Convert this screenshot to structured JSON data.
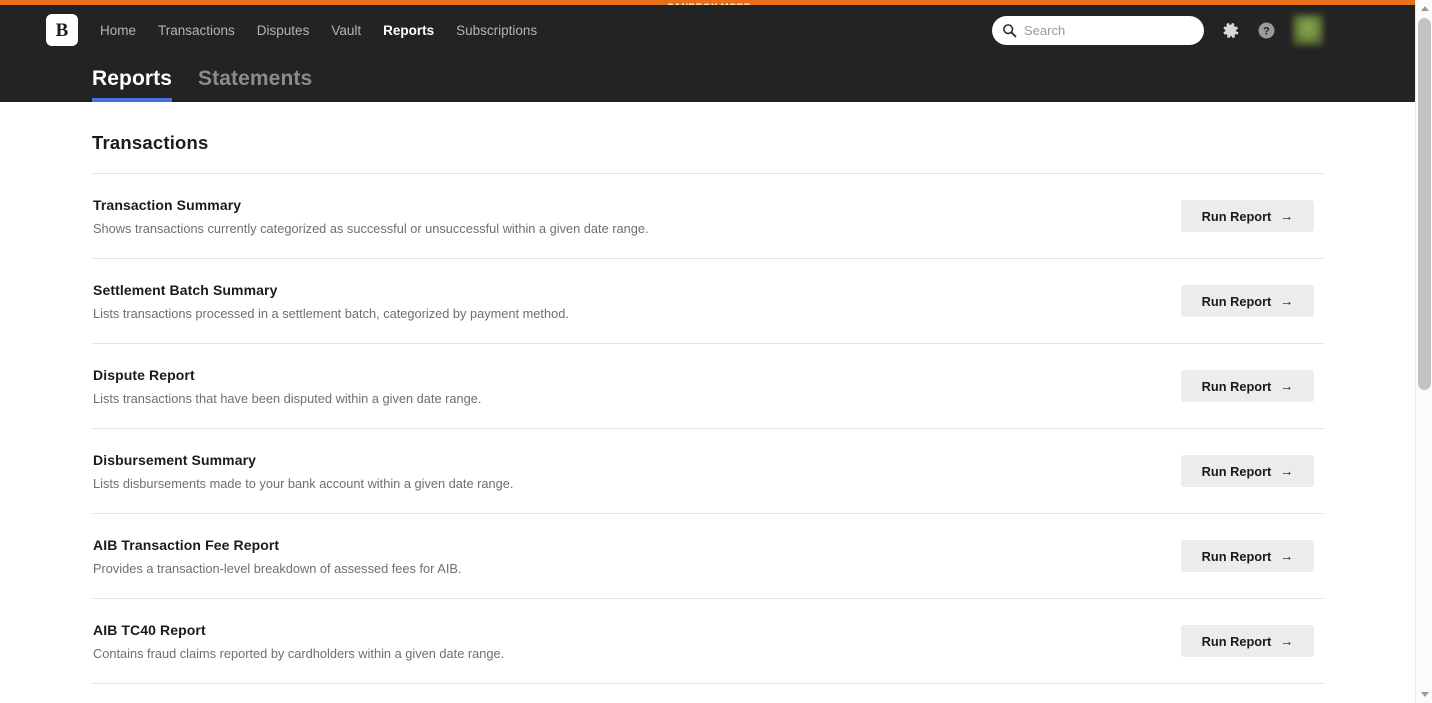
{
  "banner": {
    "sandbox_label": "SANDBOX MODE",
    "accent_color": "#e8701a"
  },
  "header": {
    "logo_letter": "B",
    "background_color": "#232323",
    "nav": [
      {
        "label": "Home",
        "active": false
      },
      {
        "label": "Transactions",
        "active": false
      },
      {
        "label": "Disputes",
        "active": false
      },
      {
        "label": "Vault",
        "active": false
      },
      {
        "label": "Reports",
        "active": true
      },
      {
        "label": "Subscriptions",
        "active": false
      }
    ],
    "search": {
      "placeholder": "Search",
      "value": ""
    },
    "icons": [
      {
        "name": "gear-icon"
      },
      {
        "name": "help-icon"
      },
      {
        "name": "avatar"
      }
    ],
    "tabs": [
      {
        "label": "Reports",
        "active": true
      },
      {
        "label": "Statements",
        "active": false
      }
    ],
    "active_tab_underline_color": "#4a6ee0"
  },
  "main": {
    "section_title": "Transactions",
    "run_button_label": "Run Report",
    "run_button_arrow": "→",
    "reports": [
      {
        "name": "Transaction Summary",
        "description": "Shows transactions currently categorized as successful or unsuccessful within a given date range."
      },
      {
        "name": "Settlement Batch Summary",
        "description": "Lists transactions processed in a settlement batch, categorized by payment method."
      },
      {
        "name": "Dispute Report",
        "description": "Lists transactions that have been disputed within a given date range."
      },
      {
        "name": "Disbursement Summary",
        "description": "Lists disbursements made to your bank account within a given date range."
      },
      {
        "name": "AIB Transaction Fee Report",
        "description": "Provides a transaction-level breakdown of assessed fees for AIB."
      },
      {
        "name": "AIB TC40 Report",
        "description": "Contains fraud claims reported by cardholders within a given date range."
      }
    ]
  }
}
